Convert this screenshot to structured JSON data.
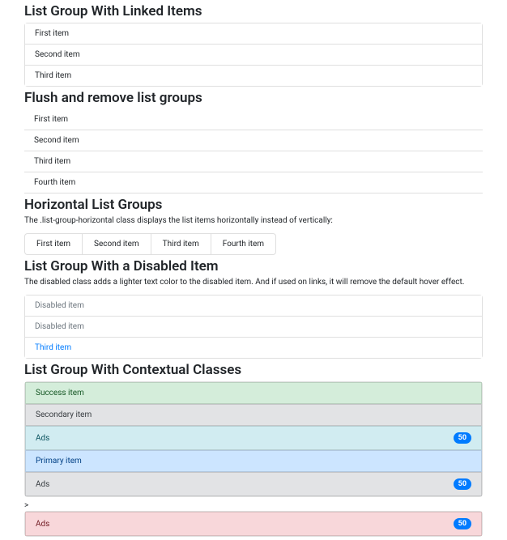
{
  "sections": {
    "linked": {
      "heading": "List Group With Linked Items",
      "items": [
        "First item",
        "Second item",
        "Third item"
      ]
    },
    "flush": {
      "heading": "Flush and remove list groups",
      "items": [
        "First item",
        "Second item",
        "Third item",
        "Fourth item"
      ]
    },
    "horizontal": {
      "heading": "Horizontal List Groups",
      "desc": "The .list-group-horizontal class displays the list items horizontally instead of vertically:",
      "items": [
        "First item",
        "Second item",
        "Third item",
        "Fourth item"
      ]
    },
    "disabled": {
      "heading": "List Group With a Disabled Item",
      "desc": "The disabled class adds a lighter text color to the disabled item. And if used on links, it will remove the default hover effect.",
      "items": [
        {
          "label": "Disabled item",
          "state": "disabled"
        },
        {
          "label": "Disabled item",
          "state": "disabled"
        },
        {
          "label": "Third item",
          "state": "link"
        }
      ]
    },
    "contextual": {
      "heading": "List Group With Contextual Classes",
      "items": [
        {
          "label": "Success item",
          "cls": "success",
          "badge": null
        },
        {
          "label": "Secondary item",
          "cls": "secondary",
          "badge": null
        },
        {
          "label": "Ads",
          "cls": "info",
          "badge": "50"
        },
        {
          "label": "Primary item",
          "cls": "primary",
          "badge": null
        },
        {
          "label": "Ads",
          "cls": "secondary",
          "badge": "50"
        }
      ],
      "caret": ">",
      "extra": {
        "label": "Ads",
        "cls": "danger",
        "badge": "50"
      }
    }
  }
}
